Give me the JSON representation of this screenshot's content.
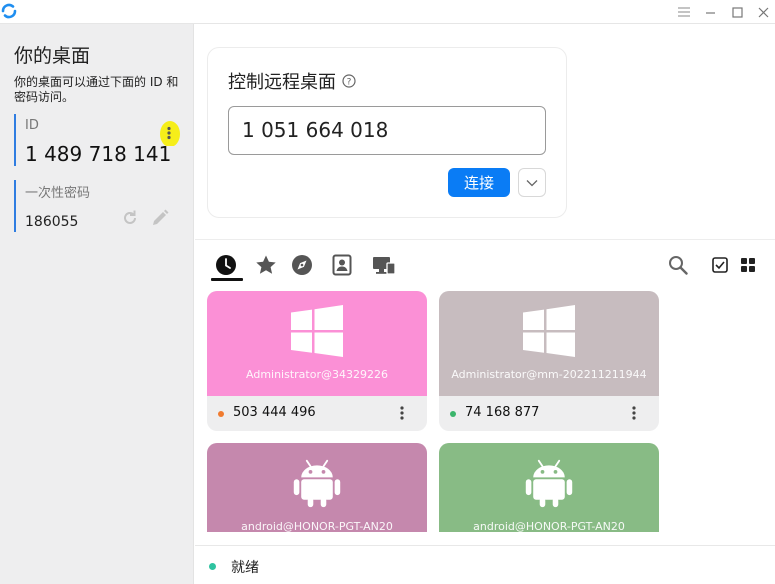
{
  "colors": {
    "accent": "#0a7cf5",
    "id_bar": "#2f7de1",
    "highlight": "#f6ee1a",
    "online": "#3bb56c",
    "offline": "#f07b2f",
    "ready": "#2ec3a0"
  },
  "titlebar": {
    "icons": [
      "rustdesk-logo-icon",
      "hamburger-menu-icon",
      "minimize-icon",
      "maximize-icon",
      "close-icon"
    ]
  },
  "left": {
    "title": "你的桌面",
    "description": "你的桌面可以通过下面的 ID 和密码访问。",
    "id_label": "ID",
    "id_value": "1 489 718 141",
    "password_label": "一次性密码",
    "password_value": "186055"
  },
  "connect": {
    "title": "控制远程桌面",
    "input_value": "1 051 664 018",
    "connect_label": "连接"
  },
  "tabs": [
    {
      "icon": "recent-clock-icon",
      "active": true
    },
    {
      "icon": "favorites-star-icon",
      "active": false
    },
    {
      "icon": "discovered-compass-icon",
      "active": false
    },
    {
      "icon": "address-book-icon",
      "active": false
    },
    {
      "icon": "group-devices-icon",
      "active": false
    }
  ],
  "peers": [
    {
      "user": "Administrator@34329226",
      "id": "503 444 496",
      "os": "windows",
      "color": "#fb90d6",
      "status": "offline"
    },
    {
      "user": "Administrator@mm-202211211944",
      "id": "74 168 877",
      "os": "windows",
      "color": "#c7bcbf",
      "status": "online"
    },
    {
      "user": "android@HONOR-PGT-AN20",
      "id": "",
      "os": "android",
      "color": "#c588ad",
      "status": ""
    },
    {
      "user": "android@HONOR-PGT-AN20",
      "id": "",
      "os": "android",
      "color": "#88bb85",
      "status": ""
    }
  ],
  "statusbar": {
    "text": "就绪"
  }
}
